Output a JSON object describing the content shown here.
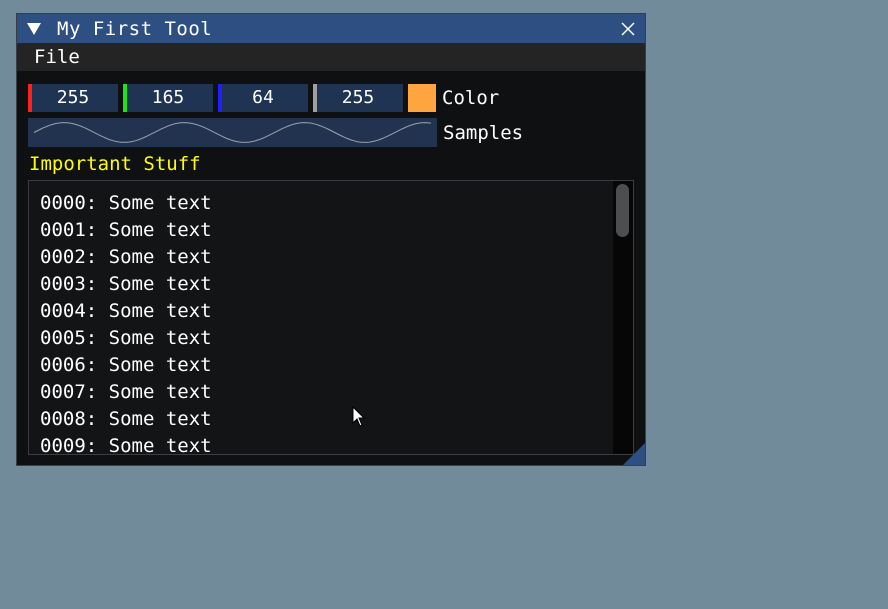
{
  "window": {
    "title": "My First Tool"
  },
  "menu": {
    "items": [
      "File"
    ]
  },
  "color_editor": {
    "values": [
      {
        "value": "255",
        "stripe": "#ff2020"
      },
      {
        "value": "165",
        "stripe": "#20e020"
      },
      {
        "value": "64",
        "stripe": "#2020ff"
      },
      {
        "value": "255",
        "stripe": "#a0a0a0"
      }
    ],
    "swatch_color": "#ffa540",
    "label": "Color"
  },
  "samples": {
    "label": "Samples",
    "line_color": "#9aa3ad"
  },
  "section": {
    "title": "Important Stuff"
  },
  "list": {
    "items": [
      "0000: Some text",
      "0001: Some text",
      "0002: Some text",
      "0003: Some text",
      "0004: Some text",
      "0005: Some text",
      "0006: Some text",
      "0007: Some text",
      "0008: Some text",
      "0009: Some text"
    ]
  },
  "colors": {
    "titlebar": "#2e4f82",
    "section_header": "#ffff00",
    "desktop": "#728b9a"
  },
  "icons": {
    "collapse": "triangle-down-icon",
    "close": "close-icon",
    "cursor": "mouse-pointer-icon"
  }
}
